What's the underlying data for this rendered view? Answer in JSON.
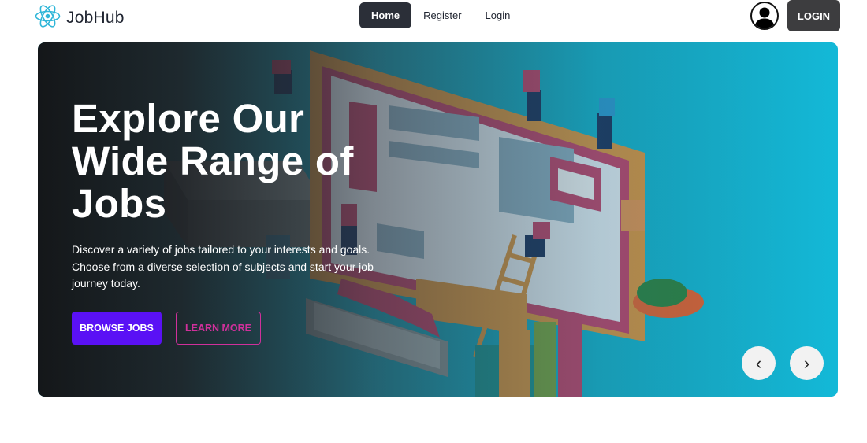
{
  "brand": {
    "name": "JobHub",
    "logo_icon": "react-atom-icon",
    "logo_color": "#2fb6d8"
  },
  "nav": {
    "items": [
      {
        "label": "Home",
        "active": true
      },
      {
        "label": "Register",
        "active": false
      },
      {
        "label": "Login",
        "active": false
      }
    ]
  },
  "header": {
    "avatar_icon": "user-avatar-icon",
    "login_label": "LOGIN"
  },
  "hero": {
    "title": "Explore Our Wide Range of Jobs",
    "description": "Discover a variety of jobs tailored to your interests and goals. Choose from a diverse selection of subjects and start your job journey today.",
    "primary_button": "BROWSE JOBS",
    "secondary_button": "LEARN MORE",
    "prev_icon": "‹",
    "next_icon": "›",
    "colors": {
      "primary": "#5a11f5",
      "secondary": "#d0309b",
      "background": "#16b7d6"
    }
  }
}
